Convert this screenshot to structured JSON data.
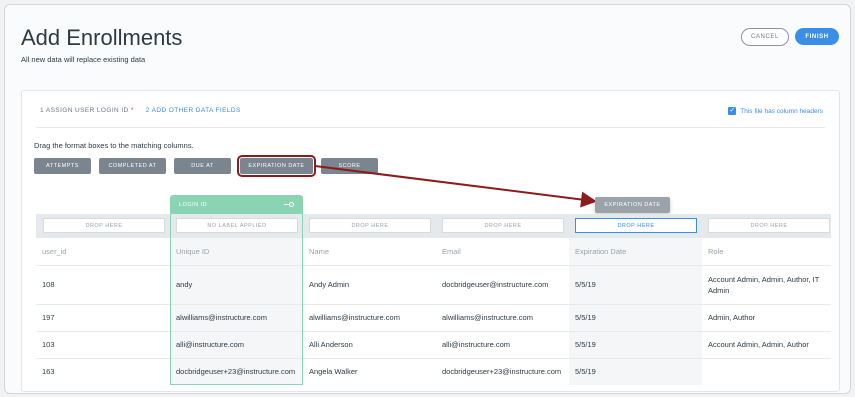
{
  "page": {
    "title": "Add Enrollments",
    "subtitle": "All new data will replace existing data",
    "cancel_label": "CANCEL",
    "finish_label": "FINISH"
  },
  "steps": {
    "step1_label": "1  ASSIGN USER LOGIN ID",
    "step1_required": "*",
    "step2_label": "2  ADD OTHER DATA FIELDS",
    "column_headers_label": "This file has column headers",
    "column_headers_checked": true
  },
  "instruction": "Drag the format boxes to the matching columns.",
  "format_boxes": [
    "ATTEMPTS",
    "COMPLETED AT",
    "DUE AT",
    "EXPIRATION DATE",
    "SCORE"
  ],
  "dragging_box": "EXPIRATION DATE",
  "login_tab": {
    "label": "LOGIN ID",
    "icon": "key-icon"
  },
  "drop_zones": [
    "DROP HERE",
    "NO LABEL APPLIED",
    "DROP HERE",
    "DROP HERE",
    "DROP HERE",
    "DROP HERE"
  ],
  "table": {
    "headers": [
      "user_id",
      "Unique ID",
      "Name",
      "Email",
      "Expiration Date",
      "Role"
    ],
    "rows": [
      [
        "108",
        "andy",
        "Andy Admin",
        "docbridgeuser@instructure.com",
        "5/5/19",
        "Account Admin, Admin, Author, IT Admin"
      ],
      [
        "197",
        "alwilliams@instructure.com",
        "alwilliams@instructure.com",
        "alwilliams@instructure.com",
        "5/5/19",
        "Admin, Author"
      ],
      [
        "103",
        "alli@instructure.com",
        "Alli Anderson",
        "alli@instructure.com",
        "5/5/19",
        "Account Admin, Admin, Author"
      ],
      [
        "163",
        "docbridgeuser+23@instructure.com",
        "Angela Walker",
        "docbridgeuser+23@instructure.com",
        "5/5/19",
        ""
      ]
    ]
  },
  "colors": {
    "accent": "#3a8ee6",
    "login_green": "#8ad4b3",
    "highlight_red": "#8b1c1c",
    "format_box_gray": "#7a858f"
  }
}
